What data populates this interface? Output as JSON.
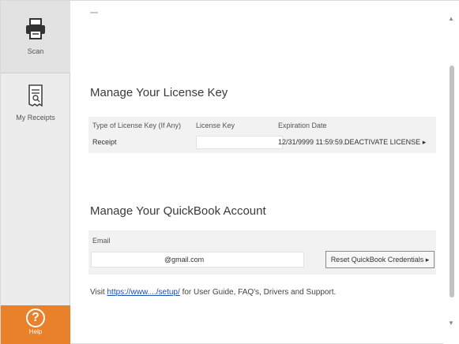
{
  "sidebar": {
    "scan": {
      "label": "Scan",
      "icon": "printer-icon"
    },
    "receipts": {
      "label": "My Receipts",
      "icon": "receipt-icon"
    },
    "help": {
      "label": "Help",
      "icon": "help-icon",
      "glyph": "?"
    }
  },
  "license": {
    "title": "Manage Your License Key",
    "columns": [
      "Type of License Key (If Any)",
      "License Key",
      "Expiration Date"
    ],
    "row": {
      "type": "Receipt",
      "key": "",
      "expiration": "12/31/9999 11:59:59...",
      "action_label": "DEACTIVATE LICENSE",
      "action_arrow": "▸"
    }
  },
  "quickbooks": {
    "title": "Manage Your QuickBook Account",
    "email_label": "Email",
    "email_value": "@gmail.com",
    "reset_label": "Reset QuickBook Credentials",
    "reset_arrow": "▸"
  },
  "footer": {
    "prefix": "Visit",
    "link_start": "https://www.",
    "link_middle": "...",
    "link_end": "/setup/",
    "suffix": "for User Guide, FAQ's, Drivers and Support."
  },
  "colors": {
    "help_orange": "#e8812a",
    "link_blue": "#1a4fb5",
    "sidebar_gray": "#ececec"
  }
}
